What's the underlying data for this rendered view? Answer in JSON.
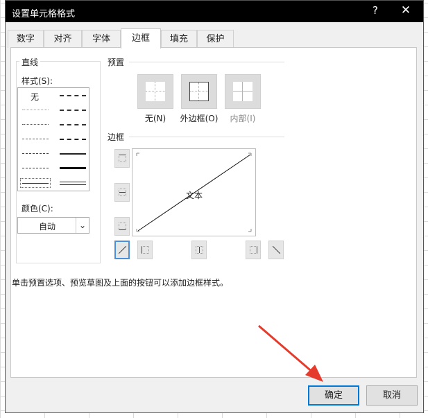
{
  "dialog": {
    "title": "设置单元格格式",
    "help": "?",
    "close": "✕"
  },
  "tabs": [
    "数字",
    "对齐",
    "字体",
    "边框",
    "填充",
    "保护"
  ],
  "active_tab": "边框",
  "line_section": {
    "group_title": "直线",
    "style_label": "样式(S):",
    "style_none": "无",
    "color_label": "颜色(C):",
    "color_value": "自动"
  },
  "presets_section": {
    "group_title": "预置",
    "presets": [
      {
        "label": "无(N)"
      },
      {
        "label": "外边框(O)"
      },
      {
        "label": "内部(I)"
      }
    ]
  },
  "border_section": {
    "group_title": "边框",
    "preview_text": "文本"
  },
  "hint": "单击预置选项、预览草图及上面的按钮可以添加边框样式。",
  "buttons": {
    "ok": "确定",
    "cancel": "取消"
  },
  "colors": {
    "accent": "#0078d7",
    "arrow": "#e53b2c",
    "titlebar": "#000000",
    "dialog_bg": "#f0f0f0"
  }
}
